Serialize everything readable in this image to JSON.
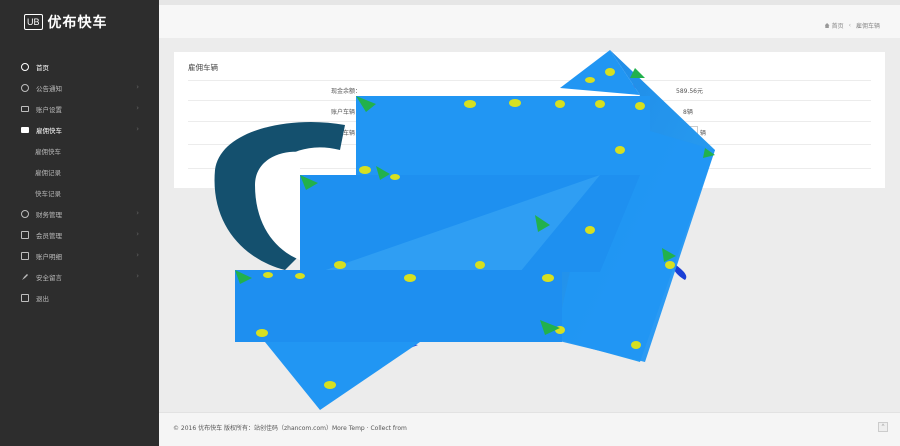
{
  "sidebar": {
    "logo_badge": "UB",
    "logo_text": "优布快车",
    "items": [
      {
        "label": "首页",
        "icon": "globe-icon",
        "active": true
      },
      {
        "label": "公告通知",
        "icon": "globe-icon",
        "active": false
      },
      {
        "label": "账户设置",
        "icon": "monitor-icon",
        "active": false
      },
      {
        "label": "雇佣快车",
        "icon": "card-icon",
        "active": true
      },
      {
        "label": "雇佣快车",
        "icon": "",
        "active": false,
        "sub": true
      },
      {
        "label": "雇佣记录",
        "icon": "",
        "active": false,
        "sub": true
      },
      {
        "label": "快车记录",
        "icon": "",
        "active": false,
        "sub": true
      },
      {
        "label": "财务管理",
        "icon": "globe-icon",
        "active": false
      },
      {
        "label": "会员管理",
        "icon": "square-icon",
        "active": false
      },
      {
        "label": "账户明细",
        "icon": "square-icon",
        "active": false
      },
      {
        "label": "安全留言",
        "icon": "rocket-icon",
        "active": false
      },
      {
        "label": "退出",
        "icon": "square-icon",
        "active": false
      }
    ]
  },
  "breadcrumb": {
    "home": "首页",
    "current": "雇佣车辆"
  },
  "panel": {
    "title": "雇佣车辆",
    "rows": [
      {
        "label": "现金余额：",
        "value": "589.56元"
      },
      {
        "label": "账户车辆：",
        "value": "8辆"
      },
      {
        "label": "雇佣车辆：",
        "value": "辆"
      }
    ]
  },
  "footer": {
    "text": "© 2016 优布快车 版权所有：站创佳码（zhancom.com）More Temp · Collect from"
  },
  "colors": {
    "sidebar_bg": "#2d2d2d",
    "content_bg": "#ececec",
    "overlay_blue": "#2196f3",
    "leaf_yellow": "#d6e021",
    "leaf_green": "#22b14c"
  }
}
